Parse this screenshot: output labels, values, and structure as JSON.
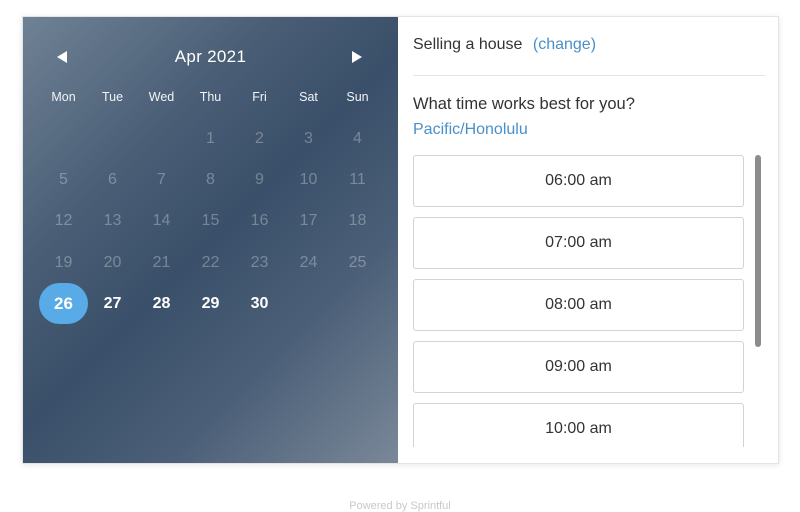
{
  "calendar": {
    "month_title": "Apr 2021",
    "prev_icon": "triangle-left-icon",
    "next_icon": "triangle-right-icon",
    "weekdays": [
      "Mon",
      "Tue",
      "Wed",
      "Thu",
      "Fri",
      "Sat",
      "Sun"
    ],
    "days": [
      {
        "label": "",
        "state": "empty"
      },
      {
        "label": "",
        "state": "empty"
      },
      {
        "label": "",
        "state": "empty"
      },
      {
        "label": "1",
        "state": "disabled"
      },
      {
        "label": "2",
        "state": "disabled"
      },
      {
        "label": "3",
        "state": "disabled"
      },
      {
        "label": "4",
        "state": "disabled"
      },
      {
        "label": "5",
        "state": "disabled"
      },
      {
        "label": "6",
        "state": "disabled"
      },
      {
        "label": "7",
        "state": "disabled"
      },
      {
        "label": "8",
        "state": "disabled"
      },
      {
        "label": "9",
        "state": "disabled"
      },
      {
        "label": "10",
        "state": "disabled"
      },
      {
        "label": "11",
        "state": "disabled"
      },
      {
        "label": "12",
        "state": "disabled"
      },
      {
        "label": "13",
        "state": "disabled"
      },
      {
        "label": "14",
        "state": "disabled"
      },
      {
        "label": "15",
        "state": "disabled"
      },
      {
        "label": "16",
        "state": "disabled"
      },
      {
        "label": "17",
        "state": "disabled"
      },
      {
        "label": "18",
        "state": "disabled"
      },
      {
        "label": "19",
        "state": "disabled"
      },
      {
        "label": "20",
        "state": "disabled"
      },
      {
        "label": "21",
        "state": "disabled"
      },
      {
        "label": "22",
        "state": "disabled"
      },
      {
        "label": "23",
        "state": "disabled"
      },
      {
        "label": "24",
        "state": "disabled"
      },
      {
        "label": "25",
        "state": "disabled"
      },
      {
        "label": "26",
        "state": "selected"
      },
      {
        "label": "27",
        "state": "active"
      },
      {
        "label": "28",
        "state": "active"
      },
      {
        "label": "29",
        "state": "active"
      },
      {
        "label": "30",
        "state": "active"
      }
    ]
  },
  "event": {
    "name": "Selling a house",
    "change_label": "(change)"
  },
  "time": {
    "prompt": "What time works best for you?",
    "timezone": "Pacific/Honolulu",
    "slots": [
      "06:00 am",
      "07:00 am",
      "08:00 am",
      "09:00 am",
      "10:00 am"
    ]
  },
  "footer": {
    "text": "Powered by Sprintful"
  },
  "colors": {
    "accent": "#58abe6",
    "link": "#4a90c8"
  }
}
